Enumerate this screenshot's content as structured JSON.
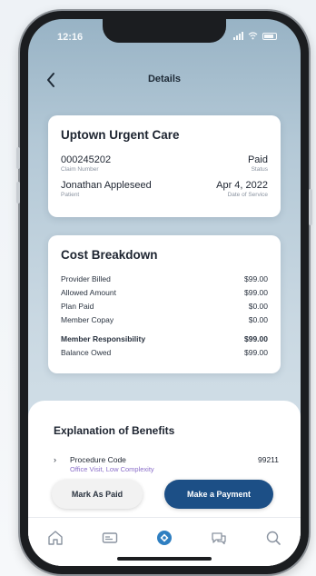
{
  "status_bar": {
    "time": "12:16"
  },
  "nav": {
    "title": "Details"
  },
  "claim": {
    "provider": "Uptown Urgent Care",
    "claim_number": "000245202",
    "claim_number_label": "Claim Number",
    "status": "Paid",
    "status_label": "Status",
    "patient": "Jonathan Appleseed",
    "patient_label": "Patient",
    "date_of_service": "Apr 4, 2022",
    "date_of_service_label": "Date of Service"
  },
  "cost_breakdown": {
    "title": "Cost Breakdown",
    "rows": [
      {
        "label": "Provider Billed",
        "value": "$99.00"
      },
      {
        "label": "Allowed Amount",
        "value": "$99.00"
      },
      {
        "label": "Plan Paid",
        "value": "$0.00"
      },
      {
        "label": "Member Copay",
        "value": "$0.00"
      }
    ],
    "totals": [
      {
        "label": "Member Responsibility",
        "value": "$99.00"
      },
      {
        "label": "Balance Owed",
        "value": "$99.00"
      }
    ]
  },
  "eob": {
    "title": "Explanation of Benefits",
    "items": [
      {
        "name": "Procedure Code",
        "description": "Office Visit, Low Complexity",
        "code": "99211"
      }
    ]
  },
  "actions": {
    "mark_paid": "Mark As Paid",
    "make_payment": "Make a Payment"
  },
  "tabs": [
    {
      "icon": "home-icon"
    },
    {
      "icon": "id-card-icon"
    },
    {
      "icon": "claims-icon"
    },
    {
      "icon": "chat-icon"
    },
    {
      "icon": "search-icon"
    }
  ],
  "colors": {
    "accent": "#1c4f86",
    "active_tab": "#2f7fc1",
    "eob_description": "#8a6ec9"
  }
}
